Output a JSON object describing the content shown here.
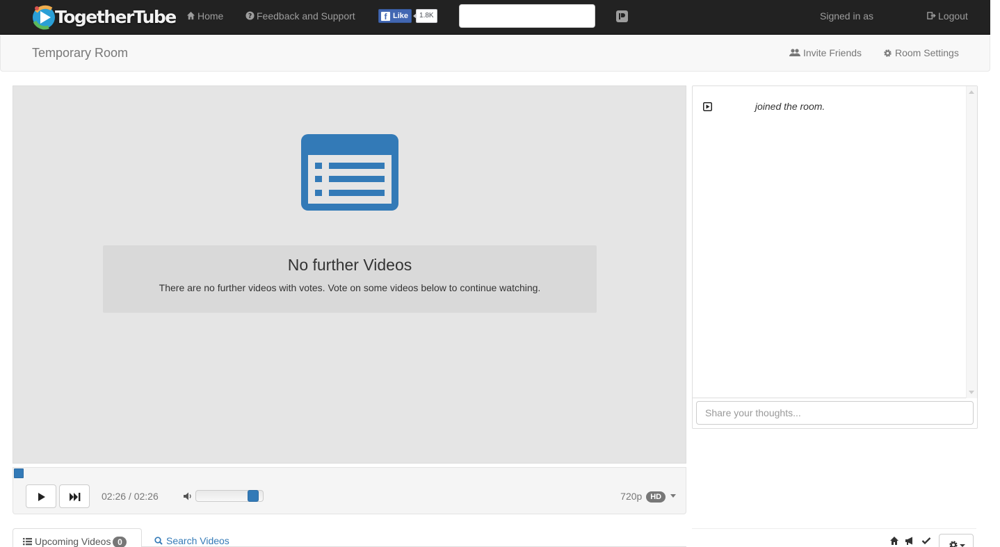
{
  "app": {
    "brand": "TogetherTube",
    "colors": {
      "accent": "#337ab7",
      "navbar": "#222222",
      "player_bg": "#e5e5e5"
    }
  },
  "navbar": {
    "home_label": "Home",
    "feedback_label": "Feedback and Support",
    "facebook": {
      "like_label": "Like",
      "count": "1.8K"
    },
    "search_placeholder": "",
    "signed_in_label": "Signed in as",
    "logout_label": "Logout",
    "icons": [
      "home-icon",
      "question-circle-icon",
      "facebook-icon",
      "pushbullet-icon",
      "logout-icon"
    ]
  },
  "subnav": {
    "room_title": "Temporary Room",
    "invite_label": "Invite Friends",
    "settings_label": "Room Settings",
    "icons": [
      "users-icon",
      "gear-icon"
    ]
  },
  "player": {
    "icon": "playlist-icon",
    "message_title": "No further Videos",
    "message_text": "There are no further videos with votes. Vote on some videos below to continue watching."
  },
  "controls": {
    "time": "02:26 / 02:26",
    "progress_fraction": 0.0,
    "volume_fraction": 0.92,
    "quality_label": "720p",
    "hd_badge": "HD",
    "icons": [
      "play-icon",
      "skip-forward-icon",
      "volume-icon",
      "caret-down-icon"
    ]
  },
  "chat": {
    "messages": [
      {
        "icon": "user-youtube-icon",
        "user": "",
        "text": "joined the room."
      }
    ],
    "input_placeholder": "Share your thoughts..."
  },
  "tabs": {
    "upcoming_label": "Upcoming Videos",
    "upcoming_count": "0",
    "search_label": "Search Videos",
    "icons": [
      "list-icon",
      "search-icon"
    ]
  },
  "right_toolbar": {
    "icons": [
      "home-icon",
      "megaphone-icon",
      "check-icon",
      "gear-dropdown-icon"
    ]
  }
}
